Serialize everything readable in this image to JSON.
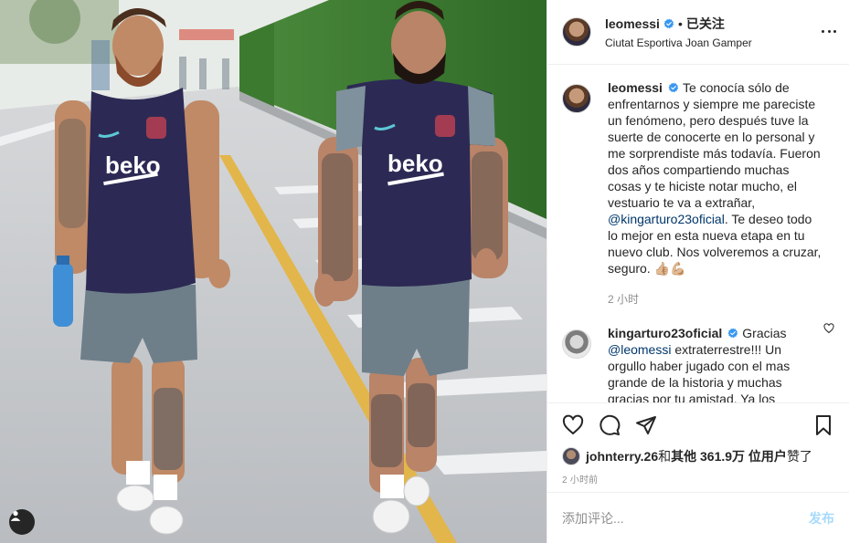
{
  "post": {
    "author": {
      "username": "leomessi",
      "verified": true,
      "follow_state": "已关注",
      "separator": "•",
      "location": "Ciutat Esportiva Joan Gamper"
    },
    "caption": {
      "username": "leomessi",
      "text_before_mention": "Te conocía sólo de enfrentarnos y siempre me pareciste un fenómeno, pero después tuve la suerte de conocerte en lo personal y me sorprendiste más todavía. Fueron dos años compartiendo muchas cosas y te hiciste notar mucho, el vestuario te va a extrañar, ",
      "mention": "@kingarturo23oficial",
      "text_after_mention": ". Te deseo todo lo mejor en esta nueva etapa en tu nuevo club. Nos volveremos a cruzar, seguro. 👍🏼💪🏼",
      "time": "2 小时"
    },
    "comment": {
      "username": "kingarturo23oficial",
      "verified": true,
      "text_before_mention": "Gracias ",
      "mention": "@leomessi",
      "text_after_mention": " extraterrestre!!! Un orgullo haber jugado con el mas grande de la historia y muchas gracias por tu amistad. Ya los extrañ... Nos vemos pronto ❤️👋"
    },
    "likes": {
      "first_liker": "johnterry.26",
      "connector": " 和 ",
      "others": "其他 361.9万 位用户",
      "suffix": " 赞了"
    },
    "timestamp": "2 小时前",
    "add_comment": {
      "placeholder": "添加评论...",
      "post_label": "发布"
    },
    "photo": {
      "jersey_text_left": "beko",
      "jersey_text_right": "beko"
    }
  },
  "icons": {
    "more": "more-horizontal-icon",
    "like": "heart-icon",
    "comment": "comment-icon",
    "share": "share-icon",
    "save": "bookmark-icon",
    "tags": "user-tag-icon"
  },
  "colors": {
    "link": "#00376b",
    "accent": "#0095f6",
    "verified": "#3897f0",
    "text": "#262626",
    "muted": "#8e8e8e"
  }
}
